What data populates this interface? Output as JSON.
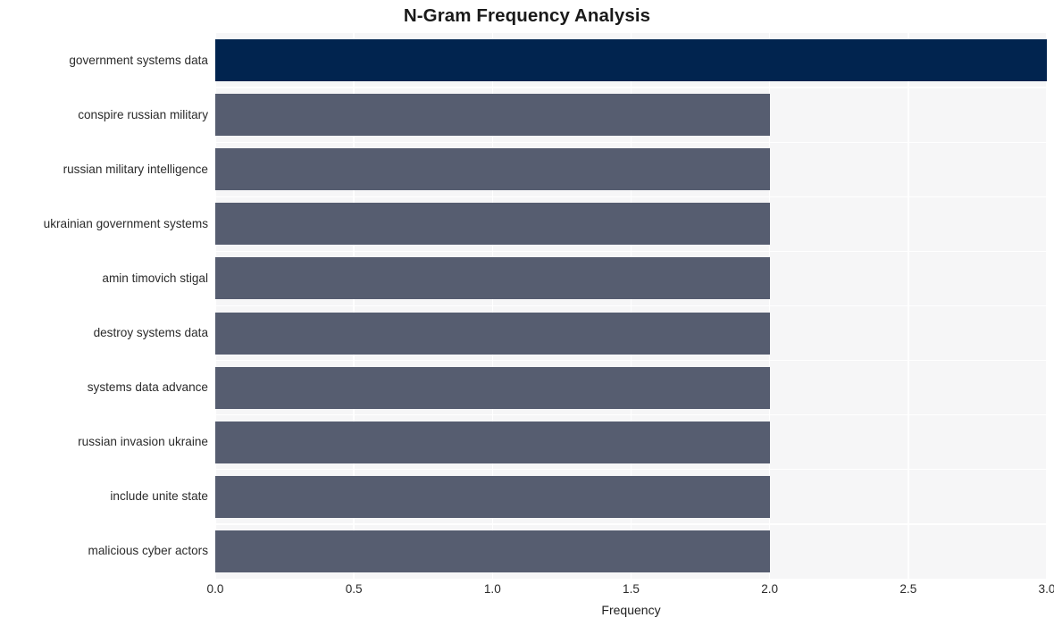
{
  "chart_data": {
    "type": "bar",
    "orientation": "horizontal",
    "title": "N-Gram Frequency Analysis",
    "xlabel": "Frequency",
    "ylabel": "",
    "categories": [
      "government systems data",
      "conspire russian military",
      "russian military intelligence",
      "ukrainian government systems",
      "amin timovich stigal",
      "destroy systems data",
      "systems data advance",
      "russian invasion ukraine",
      "include unite state",
      "malicious cyber actors"
    ],
    "values": [
      3,
      2,
      2,
      2,
      2,
      2,
      2,
      2,
      2,
      2
    ],
    "xlim": [
      0,
      3
    ],
    "xticks": [
      "0.0",
      "0.5",
      "1.0",
      "1.5",
      "2.0",
      "2.5",
      "3.0"
    ],
    "xtick_values": [
      0.0,
      0.5,
      1.0,
      1.5,
      2.0,
      2.5,
      3.0
    ],
    "grid": true,
    "legend": false,
    "bar_colors": [
      "#01244f",
      "#565d70",
      "#565d70",
      "#565d70",
      "#565d70",
      "#565d70",
      "#565d70",
      "#565d70",
      "#565d70",
      "#565d70"
    ],
    "highlight_color": "#01244f",
    "bar_color": "#565d70",
    "plot_background": "#f6f6f7",
    "gridline_color": "#ffffff",
    "figure_background": "#ffffff",
    "text_color": "#2b2b2b"
  }
}
